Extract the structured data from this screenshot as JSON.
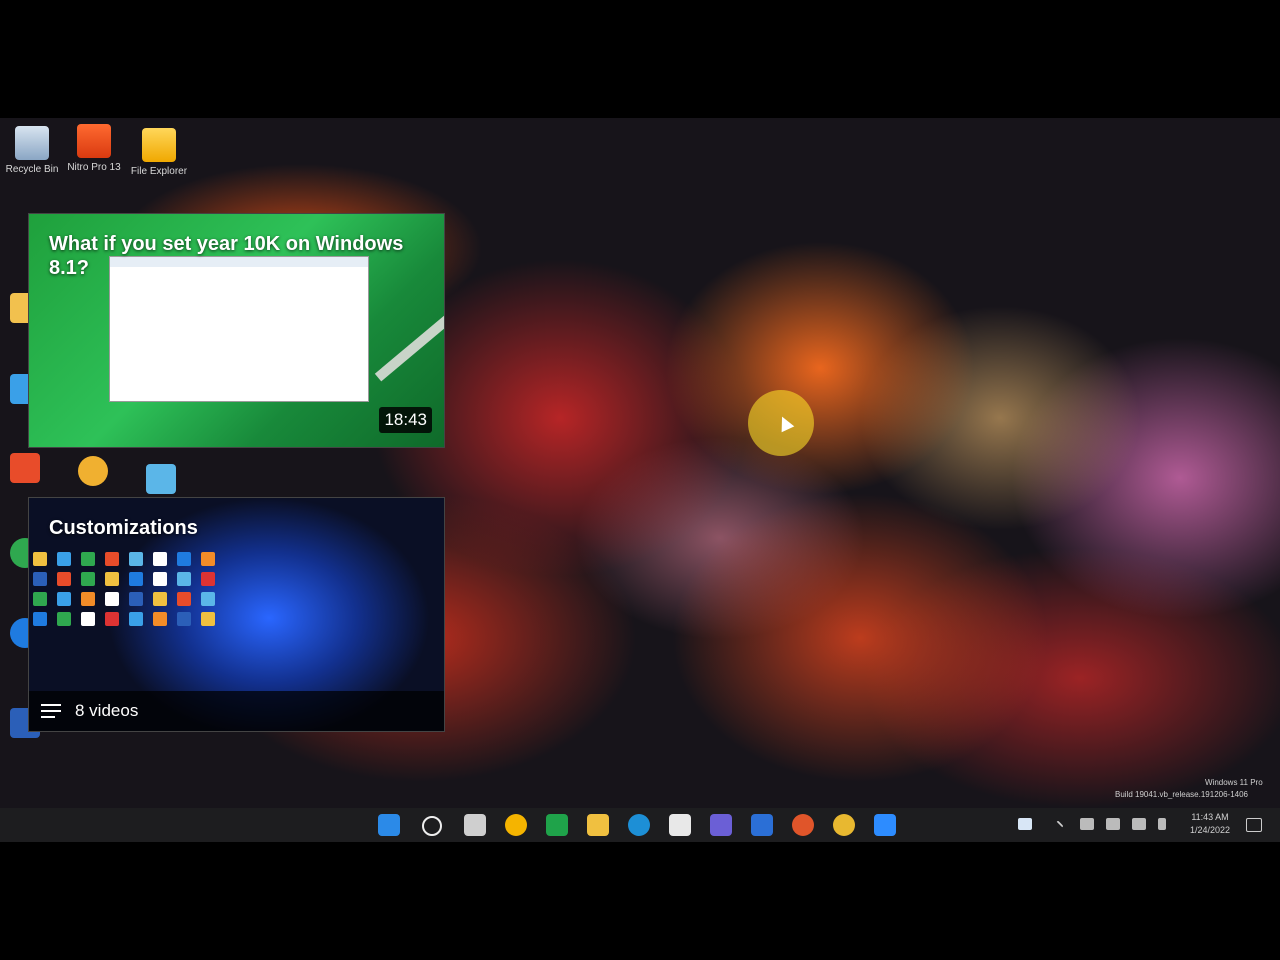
{
  "desktop": {
    "icons": [
      {
        "label": "Recycle Bin",
        "icon": "recycle-bin-icon"
      },
      {
        "label": "Nitro Pro 13",
        "icon": "nitro-pro-icon"
      },
      {
        "label": "File Explorer",
        "icon": "file-explorer-icon"
      }
    ],
    "watermark": "Windows 11 Pro",
    "build": "Build 19041.vb_release.191206-1406"
  },
  "cards": [
    {
      "title": "What if you set year 10K on Windows 8.1?",
      "duration": "18:43"
    },
    {
      "title": "Customizations",
      "playlist_count": "8 videos"
    }
  ],
  "taskbar": {
    "clock_time": "11:43 AM",
    "clock_date": "1/24/2022"
  },
  "colors": {
    "accent": "#2ec158",
    "taskbar": "#1d1d1f"
  }
}
